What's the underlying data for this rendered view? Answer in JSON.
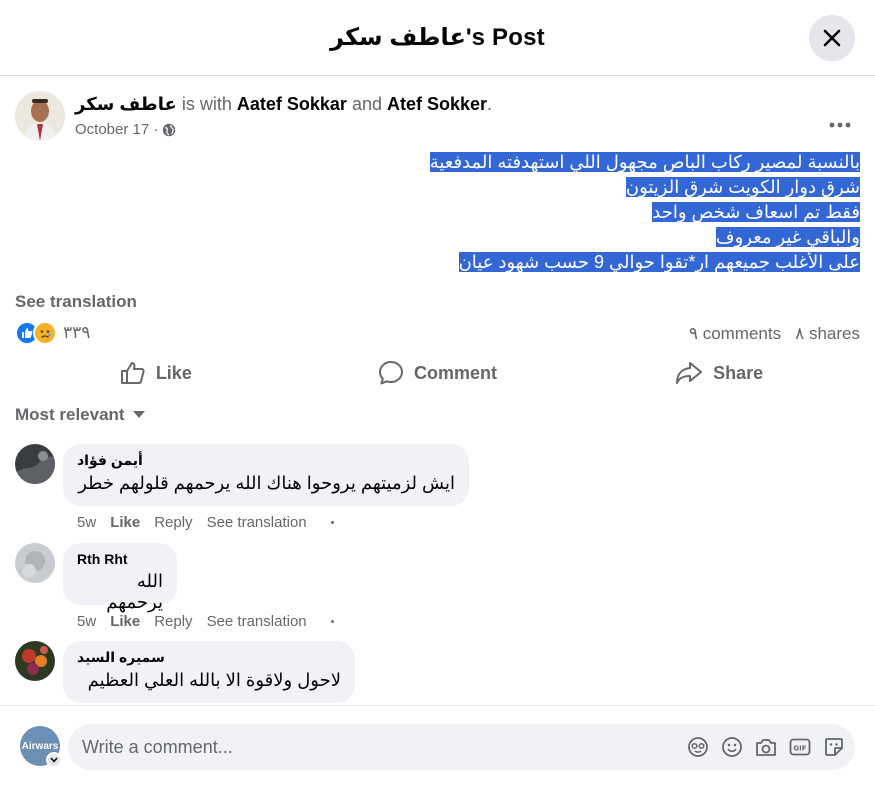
{
  "header": {
    "title": "عاطف سكر's Post"
  },
  "post": {
    "author": "عاطف سكر",
    "with_text": "is with",
    "tag1": "Aatef Sokkar",
    "and_text": "and",
    "tag2": "Atef Sokker",
    "tag_end": ".",
    "date": "October 17 ·",
    "text_lines": [
      "بالنسبة لمصير ركاب الباص مجهول اللي استهدفته المدفعية",
      "شرق دوار الكويت شرق الزيتون",
      "فقط تم اسعاف شخص واحد",
      "والباقي غير معروف",
      "على الأغلب جميعهم ار*تقوا حوالي 9 حسب شهود عيان"
    ],
    "see_translation": "See translation",
    "reaction_count": "٣٣٩",
    "comments_count": "٩ comments",
    "shares_count": "٨ shares",
    "actions": {
      "like": "Like",
      "comment": "Comment",
      "share": "Share"
    }
  },
  "comments_section": {
    "sort_label": "Most relevant",
    "comments": [
      {
        "name": "أيمن فؤاد",
        "text": "ايش لزميتهم يروحوا هناك الله يرحمهم قلولهم خطر",
        "time": "5w",
        "like": "Like",
        "reply": "Reply",
        "translate": "See translation",
        "dot": "•"
      },
      {
        "name": "Rth Rht",
        "text": "الله يرحمهم",
        "time": "5w",
        "like": "Like",
        "reply": "Reply",
        "translate": "See translation",
        "dot": "•"
      },
      {
        "name": "سميره السيد",
        "text": "لاحول ولاقوة الا بالله العلي العظيم"
      }
    ]
  },
  "composer": {
    "avatar_label": "Airwars",
    "placeholder": "Write a comment..."
  },
  "colors": {
    "highlight": "#3367d6",
    "like_blue": "#1877f2",
    "sad_yellow": "#f7b125",
    "muted": "#65676b",
    "bubble": "#f0f2f5"
  }
}
